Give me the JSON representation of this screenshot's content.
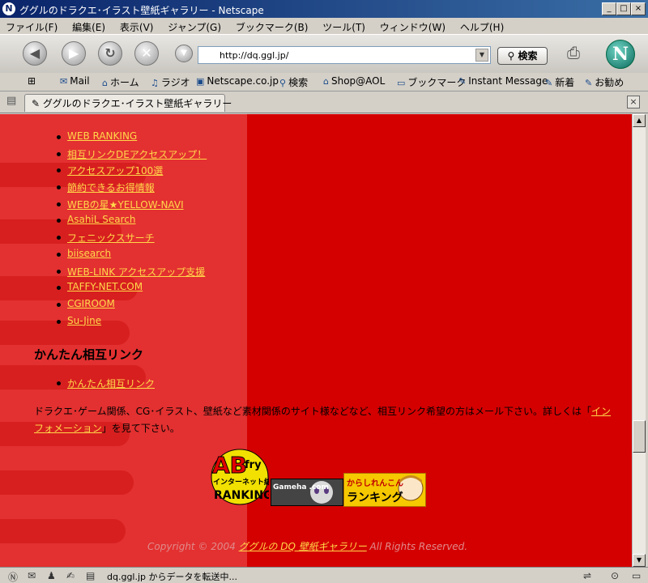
{
  "window": {
    "title": "ググルのドラクエ･イラスト壁紙ギャラリー - Netscape",
    "app_icon": "N",
    "controls": [
      "_",
      "□",
      "×"
    ]
  },
  "menu": [
    "ファイル(F)",
    "編集(E)",
    "表示(V)",
    "ジャンプ(G)",
    "ブックマーク(B)",
    "ツール(T)",
    "ウィンドウ(W)",
    "ヘルプ(H)"
  ],
  "nav": {
    "url": "http://dq.ggl.jp/",
    "search_label": "検索",
    "logo": "N"
  },
  "personal_toolbar": [
    {
      "label": "Mail",
      "icon": "mail-icon"
    },
    {
      "label": "ホーム",
      "icon": "home-icon"
    },
    {
      "label": "ラジオ",
      "icon": "radio-icon"
    },
    {
      "label": "Netscape.co.jp",
      "icon": "my-icon"
    },
    {
      "label": "検索",
      "icon": "search-icon"
    },
    {
      "label": "Shop@AOL",
      "icon": "shop-icon"
    },
    {
      "label": "ブックマーク",
      "icon": "folder-icon"
    },
    {
      "label": "Instant Message",
      "icon": "bookmark-icon"
    },
    {
      "label": "新着",
      "icon": "bookmark-icon"
    },
    {
      "label": "お勧め",
      "icon": "bookmark-icon"
    }
  ],
  "tab": {
    "label": "ググルのドラクエ･イラスト壁紙ギャラリー"
  },
  "content": {
    "links": [
      "WEB RANKING",
      "相互リンクDEアクセスアップ！",
      "アクセスアップ100選",
      "節約できるお得情報",
      "WEBの星★YELLOW-NAVI",
      "AsahiL Search",
      "フェニックスサーチ",
      "biisearch",
      "WEB-LINK アクセスアップ支援",
      "TAFFY-NET.COM",
      "CGIROOM",
      "Su-Jine"
    ],
    "heading": "かんたん相互リンク",
    "links2": [
      "かんたん相互リンク"
    ],
    "paragraph_pre": "ドラクエ･ゲーム関係、CG･イラスト、壁紙など素材関係のサイト様などなど、相互リンク希望の方はメール下さい。詳しくは「",
    "paragraph_link": "インフォメーション",
    "paragraph_post": "」を見て下さい。",
    "banners": {
      "banner1_top": "AB",
      "banner1_fry": "fry",
      "banner1_sub": "インターネット総合",
      "banner1_rank": "RANKING",
      "banner2_text": "Gameha .com",
      "banner3_top": "からしれんこん",
      "banner3_bottom": "ランキング"
    },
    "copyright_pre": "Copyright © 2004",
    "copyright_link": "ググルの DQ 壁紙ギャラリー",
    "copyright_post": "All Rights Reserved."
  },
  "status": {
    "text": "dq.ggl.jp からデータを転送中..."
  },
  "colors": {
    "page_bg": "#d40000",
    "left_band": "#e33030",
    "link": "#ffd84a"
  }
}
